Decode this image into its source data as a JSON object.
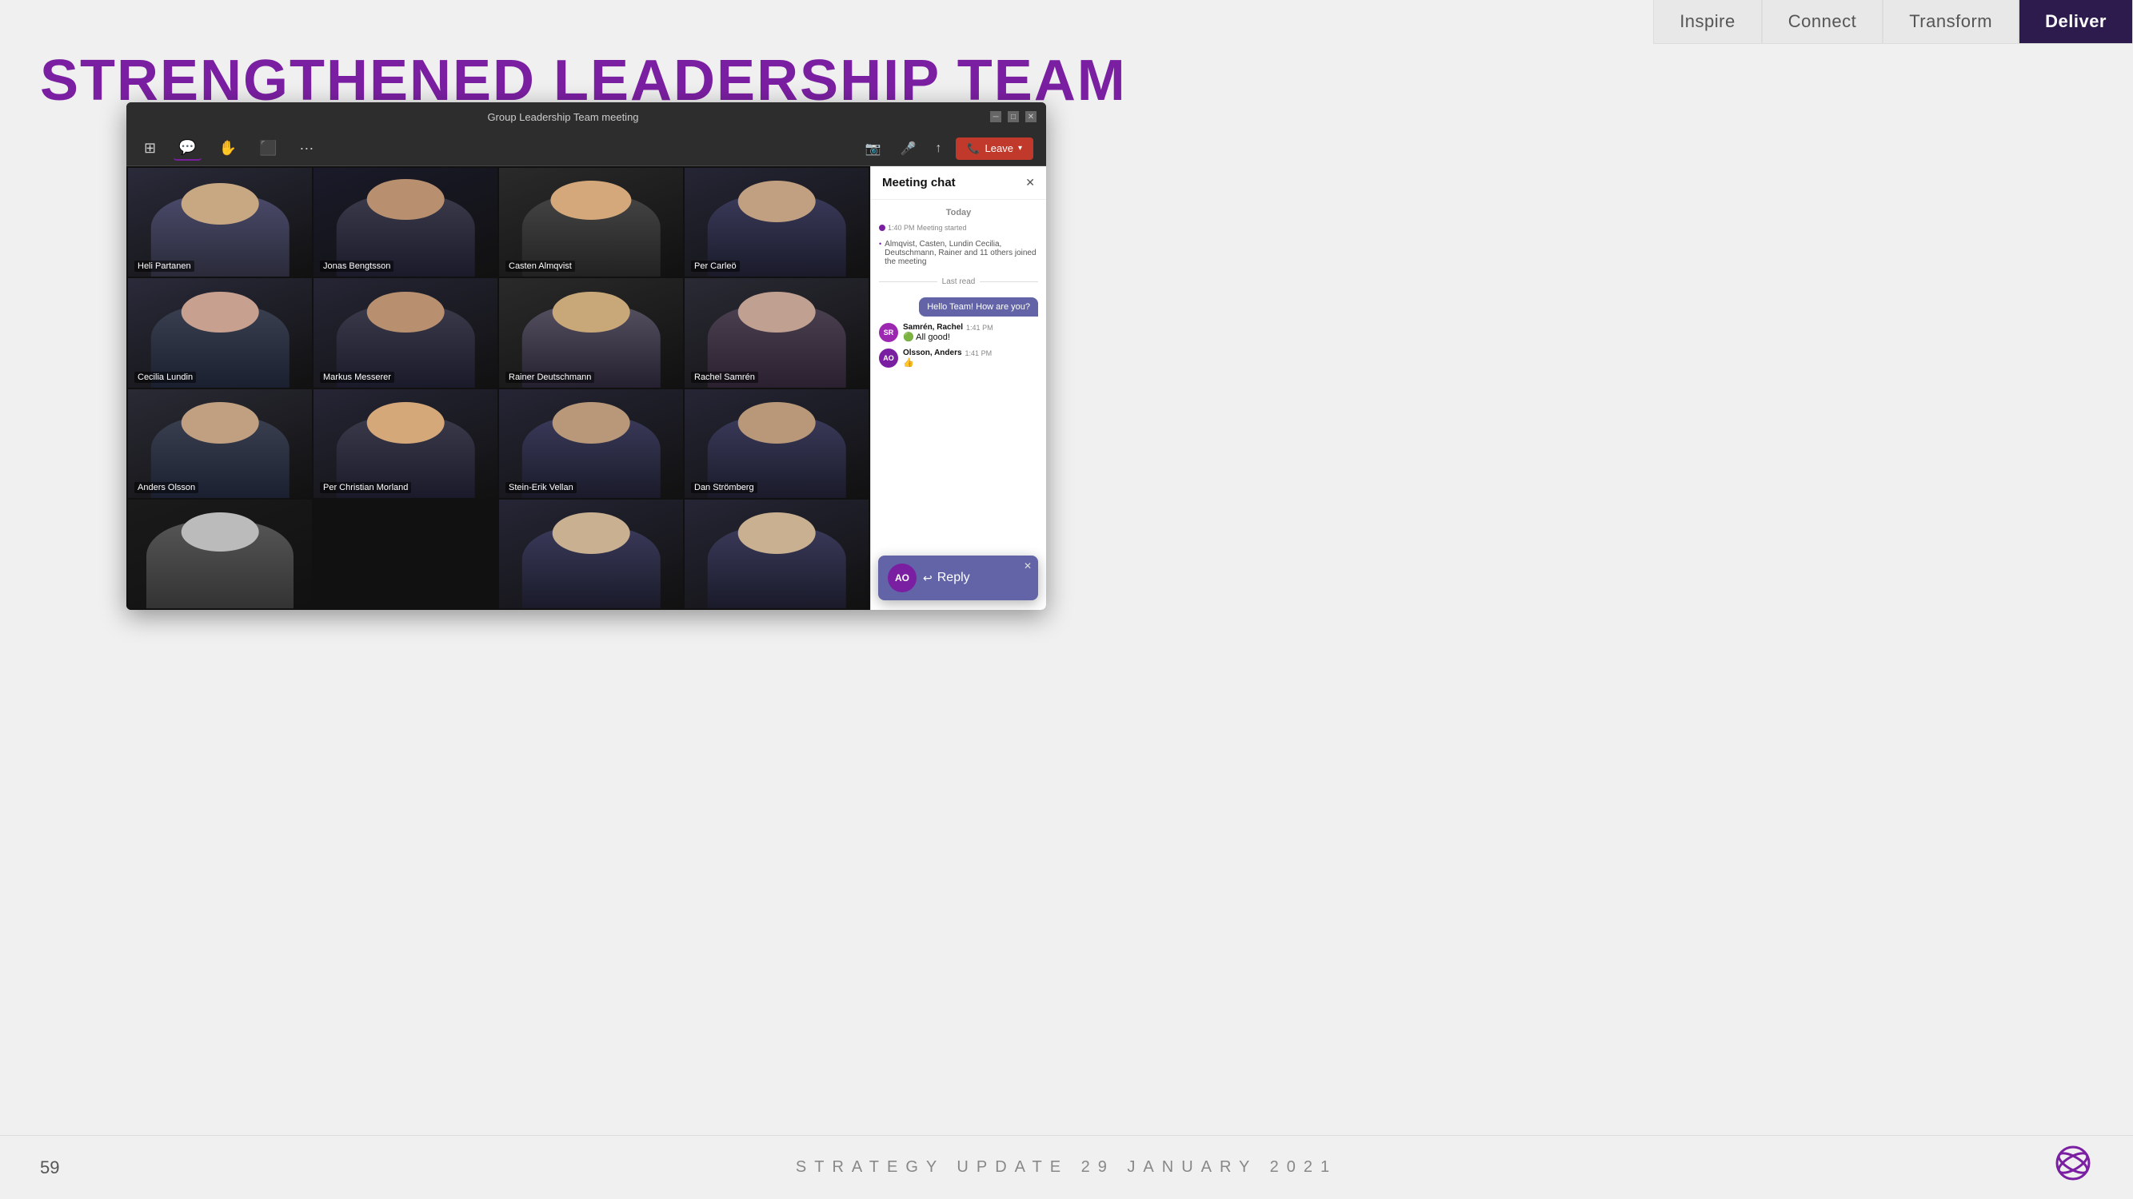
{
  "nav": {
    "items": [
      {
        "label": "Inspire",
        "active": false
      },
      {
        "label": "Connect",
        "active": false
      },
      {
        "label": "Transform",
        "active": false
      },
      {
        "label": "Deliver",
        "active": true
      }
    ]
  },
  "page": {
    "title": "STRENGTHENED LEADERSHIP TEAM",
    "number": "59",
    "footer": "STRATEGY UPDATE 29 JANUARY 2021"
  },
  "teams_window": {
    "title": "Group Leadership Team meeting",
    "participants": [
      {
        "name": "Heli Partanen",
        "highlighted": true,
        "row": 0,
        "col": 0
      },
      {
        "name": "Jonas Bengtsson",
        "highlighted": false,
        "row": 0,
        "col": 1
      },
      {
        "name": "Casten Almqvist",
        "highlighted": false,
        "row": 0,
        "col": 2
      },
      {
        "name": "Per Carleö",
        "highlighted": true,
        "row": 0,
        "col": 3
      },
      {
        "name": "Cecilia Lundin",
        "highlighted": false,
        "row": 1,
        "col": 0
      },
      {
        "name": "Markus Messerer",
        "highlighted": false,
        "row": 1,
        "col": 1
      },
      {
        "name": "Rainer Deutschmann",
        "highlighted": false,
        "row": 1,
        "col": 2
      },
      {
        "name": "Rachel Samrén",
        "highlighted": false,
        "row": 1,
        "col": 3
      },
      {
        "name": "Anders Olsson",
        "highlighted": false,
        "row": 2,
        "col": 0
      },
      {
        "name": "Per Christian Morland",
        "highlighted": false,
        "row": 2,
        "col": 1
      },
      {
        "name": "Stein-Erik Vellan",
        "highlighted": false,
        "row": 2,
        "col": 2
      },
      {
        "name": "Dan Strömberg",
        "highlighted": false,
        "row": 2,
        "col": 3
      },
      {
        "name": "",
        "highlighted": false,
        "row": 3,
        "col": 0
      },
      {
        "name": "",
        "highlighted": false,
        "row": 3,
        "col": 1
      },
      {
        "name": "",
        "highlighted": true,
        "row": 3,
        "col": 2
      },
      {
        "name": "",
        "highlighted": true,
        "row": 3,
        "col": 3
      }
    ],
    "toolbar": {
      "leave_label": "Leave"
    }
  },
  "chat": {
    "title": "Meeting chat",
    "date_label": "Today",
    "system_time": "1:40 PM",
    "system_msg": "Meeting started",
    "joined_msg": "Almqvist, Casten, Lundin Cecilia, Deutschmann, Rainer and 11 others joined the meeting",
    "last_read": "Last read",
    "bubble_msg": "Hello Team! How are you?",
    "messages": [
      {
        "sender": "Samrén, Rachel",
        "time": "1:41 PM",
        "text": "All good!",
        "emoji": "🟢",
        "initials": "SR"
      },
      {
        "sender": "Olsson, Anders",
        "time": "1:41 PM",
        "text": "👍",
        "initials": "AO"
      }
    ]
  },
  "reply_popup": {
    "label": "Reply",
    "initials": "AO"
  }
}
